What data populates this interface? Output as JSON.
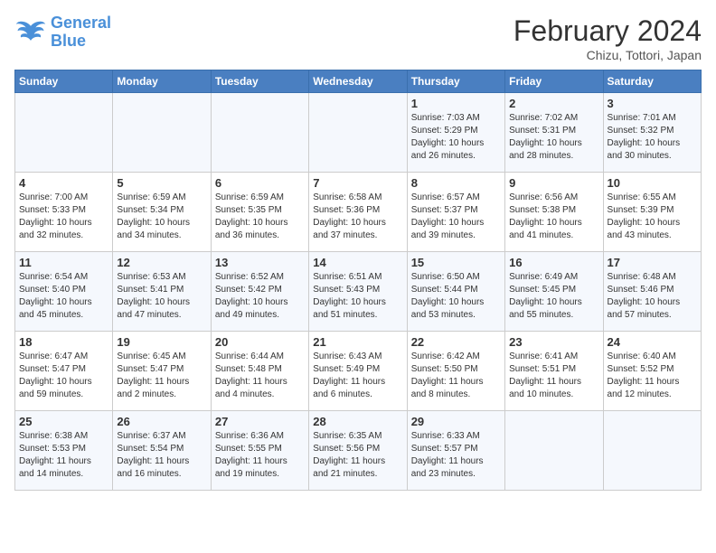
{
  "logo": {
    "line1": "General",
    "line2": "Blue"
  },
  "header": {
    "month_year": "February 2024",
    "location": "Chizu, Tottori, Japan"
  },
  "days_of_week": [
    "Sunday",
    "Monday",
    "Tuesday",
    "Wednesday",
    "Thursday",
    "Friday",
    "Saturday"
  ],
  "weeks": [
    [
      {
        "day": "",
        "info": ""
      },
      {
        "day": "",
        "info": ""
      },
      {
        "day": "",
        "info": ""
      },
      {
        "day": "",
        "info": ""
      },
      {
        "day": "1",
        "info": "Sunrise: 7:03 AM\nSunset: 5:29 PM\nDaylight: 10 hours\nand 26 minutes."
      },
      {
        "day": "2",
        "info": "Sunrise: 7:02 AM\nSunset: 5:31 PM\nDaylight: 10 hours\nand 28 minutes."
      },
      {
        "day": "3",
        "info": "Sunrise: 7:01 AM\nSunset: 5:32 PM\nDaylight: 10 hours\nand 30 minutes."
      }
    ],
    [
      {
        "day": "4",
        "info": "Sunrise: 7:00 AM\nSunset: 5:33 PM\nDaylight: 10 hours\nand 32 minutes."
      },
      {
        "day": "5",
        "info": "Sunrise: 6:59 AM\nSunset: 5:34 PM\nDaylight: 10 hours\nand 34 minutes."
      },
      {
        "day": "6",
        "info": "Sunrise: 6:59 AM\nSunset: 5:35 PM\nDaylight: 10 hours\nand 36 minutes."
      },
      {
        "day": "7",
        "info": "Sunrise: 6:58 AM\nSunset: 5:36 PM\nDaylight: 10 hours\nand 37 minutes."
      },
      {
        "day": "8",
        "info": "Sunrise: 6:57 AM\nSunset: 5:37 PM\nDaylight: 10 hours\nand 39 minutes."
      },
      {
        "day": "9",
        "info": "Sunrise: 6:56 AM\nSunset: 5:38 PM\nDaylight: 10 hours\nand 41 minutes."
      },
      {
        "day": "10",
        "info": "Sunrise: 6:55 AM\nSunset: 5:39 PM\nDaylight: 10 hours\nand 43 minutes."
      }
    ],
    [
      {
        "day": "11",
        "info": "Sunrise: 6:54 AM\nSunset: 5:40 PM\nDaylight: 10 hours\nand 45 minutes."
      },
      {
        "day": "12",
        "info": "Sunrise: 6:53 AM\nSunset: 5:41 PM\nDaylight: 10 hours\nand 47 minutes."
      },
      {
        "day": "13",
        "info": "Sunrise: 6:52 AM\nSunset: 5:42 PM\nDaylight: 10 hours\nand 49 minutes."
      },
      {
        "day": "14",
        "info": "Sunrise: 6:51 AM\nSunset: 5:43 PM\nDaylight: 10 hours\nand 51 minutes."
      },
      {
        "day": "15",
        "info": "Sunrise: 6:50 AM\nSunset: 5:44 PM\nDaylight: 10 hours\nand 53 minutes."
      },
      {
        "day": "16",
        "info": "Sunrise: 6:49 AM\nSunset: 5:45 PM\nDaylight: 10 hours\nand 55 minutes."
      },
      {
        "day": "17",
        "info": "Sunrise: 6:48 AM\nSunset: 5:46 PM\nDaylight: 10 hours\nand 57 minutes."
      }
    ],
    [
      {
        "day": "18",
        "info": "Sunrise: 6:47 AM\nSunset: 5:47 PM\nDaylight: 10 hours\nand 59 minutes."
      },
      {
        "day": "19",
        "info": "Sunrise: 6:45 AM\nSunset: 5:47 PM\nDaylight: 11 hours\nand 2 minutes."
      },
      {
        "day": "20",
        "info": "Sunrise: 6:44 AM\nSunset: 5:48 PM\nDaylight: 11 hours\nand 4 minutes."
      },
      {
        "day": "21",
        "info": "Sunrise: 6:43 AM\nSunset: 5:49 PM\nDaylight: 11 hours\nand 6 minutes."
      },
      {
        "day": "22",
        "info": "Sunrise: 6:42 AM\nSunset: 5:50 PM\nDaylight: 11 hours\nand 8 minutes."
      },
      {
        "day": "23",
        "info": "Sunrise: 6:41 AM\nSunset: 5:51 PM\nDaylight: 11 hours\nand 10 minutes."
      },
      {
        "day": "24",
        "info": "Sunrise: 6:40 AM\nSunset: 5:52 PM\nDaylight: 11 hours\nand 12 minutes."
      }
    ],
    [
      {
        "day": "25",
        "info": "Sunrise: 6:38 AM\nSunset: 5:53 PM\nDaylight: 11 hours\nand 14 minutes."
      },
      {
        "day": "26",
        "info": "Sunrise: 6:37 AM\nSunset: 5:54 PM\nDaylight: 11 hours\nand 16 minutes."
      },
      {
        "day": "27",
        "info": "Sunrise: 6:36 AM\nSunset: 5:55 PM\nDaylight: 11 hours\nand 19 minutes."
      },
      {
        "day": "28",
        "info": "Sunrise: 6:35 AM\nSunset: 5:56 PM\nDaylight: 11 hours\nand 21 minutes."
      },
      {
        "day": "29",
        "info": "Sunrise: 6:33 AM\nSunset: 5:57 PM\nDaylight: 11 hours\nand 23 minutes."
      },
      {
        "day": "",
        "info": ""
      },
      {
        "day": "",
        "info": ""
      }
    ]
  ]
}
